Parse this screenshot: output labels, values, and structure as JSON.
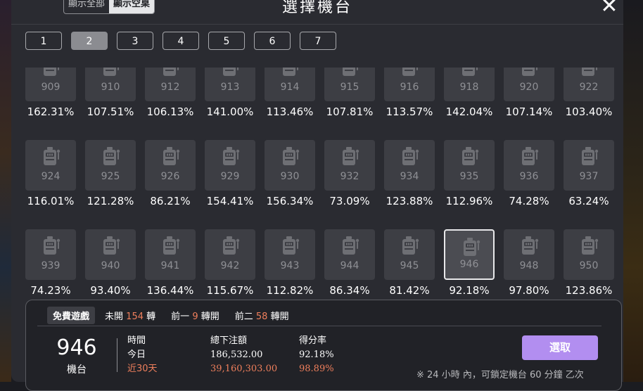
{
  "header": {
    "toggle_all": "顯示全部",
    "toggle_empty": "顯示空桌",
    "title": "選擇機台",
    "close_glyph": "✕"
  },
  "pages": [
    "1",
    "2",
    "3",
    "4",
    "5",
    "6",
    "7"
  ],
  "active_page": "2",
  "machines": [
    {
      "id": "909",
      "rate": "162.31%"
    },
    {
      "id": "910",
      "rate": "107.51%"
    },
    {
      "id": "912",
      "rate": "106.13%"
    },
    {
      "id": "913",
      "rate": "141.00%"
    },
    {
      "id": "914",
      "rate": "113.46%"
    },
    {
      "id": "915",
      "rate": "107.81%"
    },
    {
      "id": "916",
      "rate": "113.57%"
    },
    {
      "id": "918",
      "rate": "142.04%"
    },
    {
      "id": "920",
      "rate": "107.14%"
    },
    {
      "id": "922",
      "rate": "103.40%"
    },
    {
      "id": "924",
      "rate": "116.01%"
    },
    {
      "id": "925",
      "rate": "121.28%"
    },
    {
      "id": "926",
      "rate": "86.21%"
    },
    {
      "id": "929",
      "rate": "154.41%"
    },
    {
      "id": "930",
      "rate": "156.34%"
    },
    {
      "id": "932",
      "rate": "73.09%"
    },
    {
      "id": "934",
      "rate": "123.88%"
    },
    {
      "id": "935",
      "rate": "112.96%"
    },
    {
      "id": "936",
      "rate": "74.28%"
    },
    {
      "id": "937",
      "rate": "63.24%"
    },
    {
      "id": "939",
      "rate": "74.23%"
    },
    {
      "id": "940",
      "rate": "93.40%"
    },
    {
      "id": "941",
      "rate": "136.44%"
    },
    {
      "id": "942",
      "rate": "115.67%"
    },
    {
      "id": "943",
      "rate": "112.82%"
    },
    {
      "id": "944",
      "rate": "86.34%"
    },
    {
      "id": "945",
      "rate": "81.42%"
    },
    {
      "id": "946",
      "rate": "92.18%",
      "selected": true
    },
    {
      "id": "948",
      "rate": "97.80%"
    },
    {
      "id": "950",
      "rate": "123.86%"
    },
    {
      "id": "",
      "rate": ""
    },
    {
      "id": "",
      "rate": ""
    },
    {
      "id": "",
      "rate": ""
    },
    {
      "id": "",
      "rate": ""
    },
    {
      "id": "",
      "rate": ""
    },
    {
      "id": "",
      "rate": ""
    },
    {
      "id": "",
      "rate": ""
    },
    {
      "id": "",
      "rate": ""
    },
    {
      "id": "",
      "rate": ""
    },
    {
      "id": "",
      "rate": ""
    }
  ],
  "info": {
    "free_game": "免費遊戲",
    "not_open_label": "未開",
    "not_open_value": "154",
    "not_open_unit": "轉",
    "prev1_label": "前一",
    "prev1_value": "9",
    "prev1_unit": "轉開",
    "prev2_label": "前二",
    "prev2_value": "58",
    "prev2_unit": "轉開",
    "machine_number": "946",
    "machine_label": "機台",
    "col_time": "時間",
    "col_bet": "總下注額",
    "col_rate": "得分率",
    "row_today_label": "今日",
    "row_today_bet": "186,532.00",
    "row_today_rate": "92.18%",
    "row_30_label": "近30天",
    "row_30_bet": "39,160,303.00",
    "row_30_rate": "98.89%",
    "select_label": "選取",
    "note": "※ 24 小時 內，可鎖定機台 60 分鐘 乙次"
  },
  "colors": {
    "accent": "#b28ef0",
    "highlight": "#ef7f5c"
  },
  "icons": {
    "tile_icon": "slot-machine-icon",
    "close": "close-icon"
  }
}
